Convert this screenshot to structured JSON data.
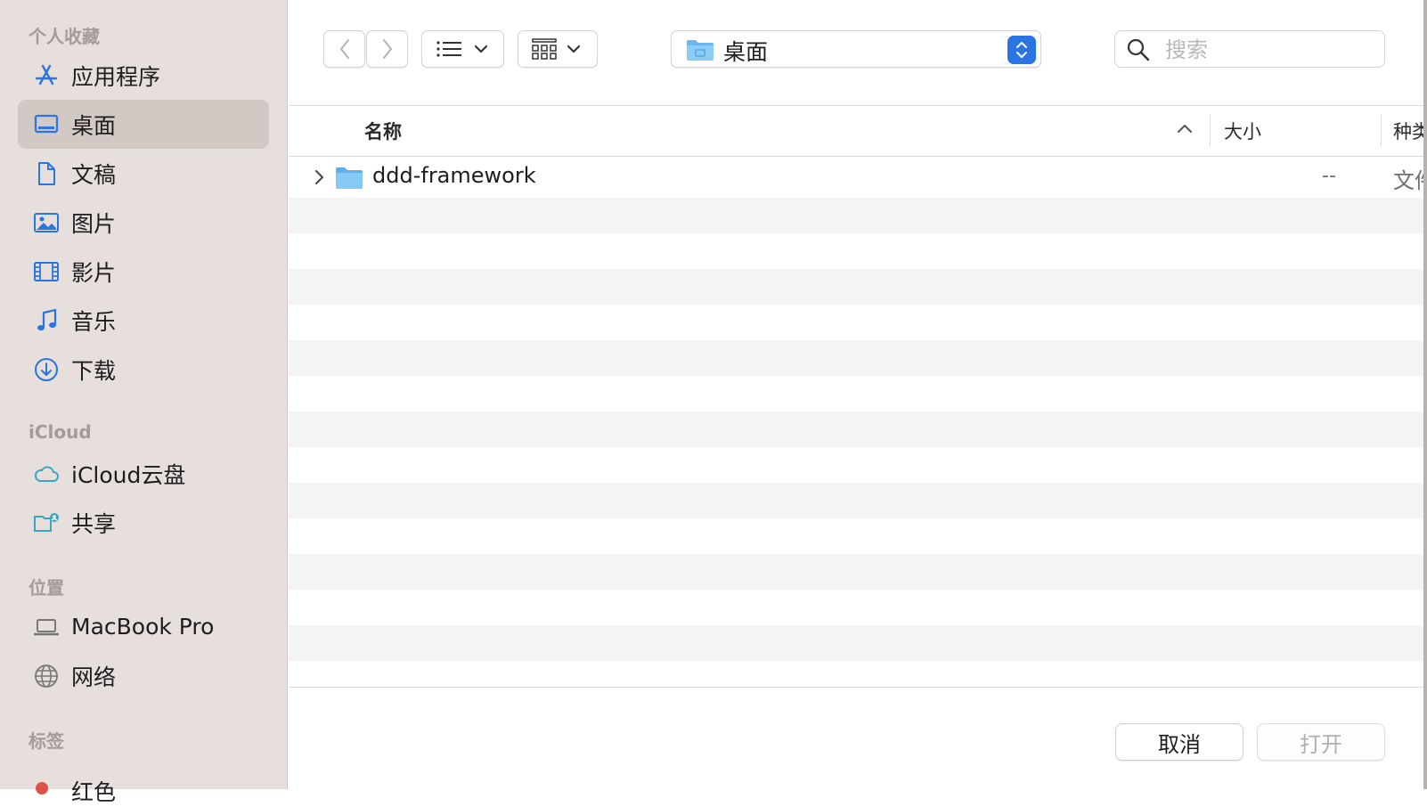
{
  "sidebar": {
    "favorites_header": "个人收藏",
    "favorites": [
      {
        "label": "应用程序",
        "icon": "app-store-icon"
      },
      {
        "label": "桌面",
        "icon": "desktop-icon",
        "selected": true
      },
      {
        "label": "文稿",
        "icon": "document-icon"
      },
      {
        "label": "图片",
        "icon": "photo-icon"
      },
      {
        "label": "影片",
        "icon": "film-icon"
      },
      {
        "label": "音乐",
        "icon": "music-note-icon"
      },
      {
        "label": "下载",
        "icon": "download-icon"
      }
    ],
    "icloud_header": "iCloud",
    "icloud": [
      {
        "label": "iCloud云盘",
        "icon": "cloud-icon"
      },
      {
        "label": "共享",
        "icon": "shared-folder-icon"
      }
    ],
    "locations_header": "位置",
    "locations": [
      {
        "label": "MacBook Pro",
        "icon": "laptop-icon"
      },
      {
        "label": "网络",
        "icon": "globe-icon"
      }
    ],
    "tags_header": "标签",
    "tags": [
      {
        "label": "红色",
        "color": "#e0514a"
      }
    ]
  },
  "toolbar": {
    "back_icon": "chevron-left-icon",
    "forward_icon": "chevron-right-icon",
    "list_view_icon": "list-view-icon",
    "group_icon": "grid-view-icon",
    "current_folder": "桌面",
    "search_placeholder": "搜索",
    "accent_color": "#2a75e3"
  },
  "columns": {
    "name": "名称",
    "size": "大小",
    "kind": "种类"
  },
  "files": [
    {
      "name": "ddd-framework",
      "size": "--",
      "kind": "文件夹",
      "icon": "folder-icon"
    }
  ],
  "footer": {
    "cancel_label": "取消",
    "open_label": "打开"
  }
}
